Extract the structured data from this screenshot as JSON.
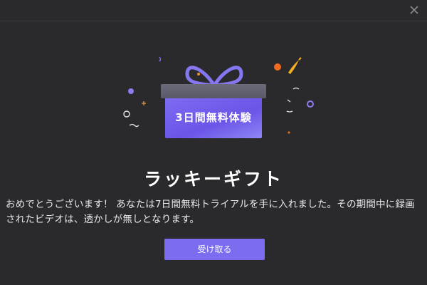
{
  "dialog": {
    "gift_label": "3日間無料体験",
    "title": "ラッキーギフト",
    "description": "おめでとうございます！ あなたは7日間無料トライアルを手に入れました。その期間中に録画されたビデオは、透かしが無しとなります。",
    "button_label": "受け取る"
  },
  "icons": {
    "close": "close-icon",
    "gift": "gift-icon",
    "confetti": "confetti-icon"
  },
  "colors": {
    "background": "#2a2a2c",
    "accent": "#7b6cf0",
    "gift_body": "#7e6cf2"
  }
}
